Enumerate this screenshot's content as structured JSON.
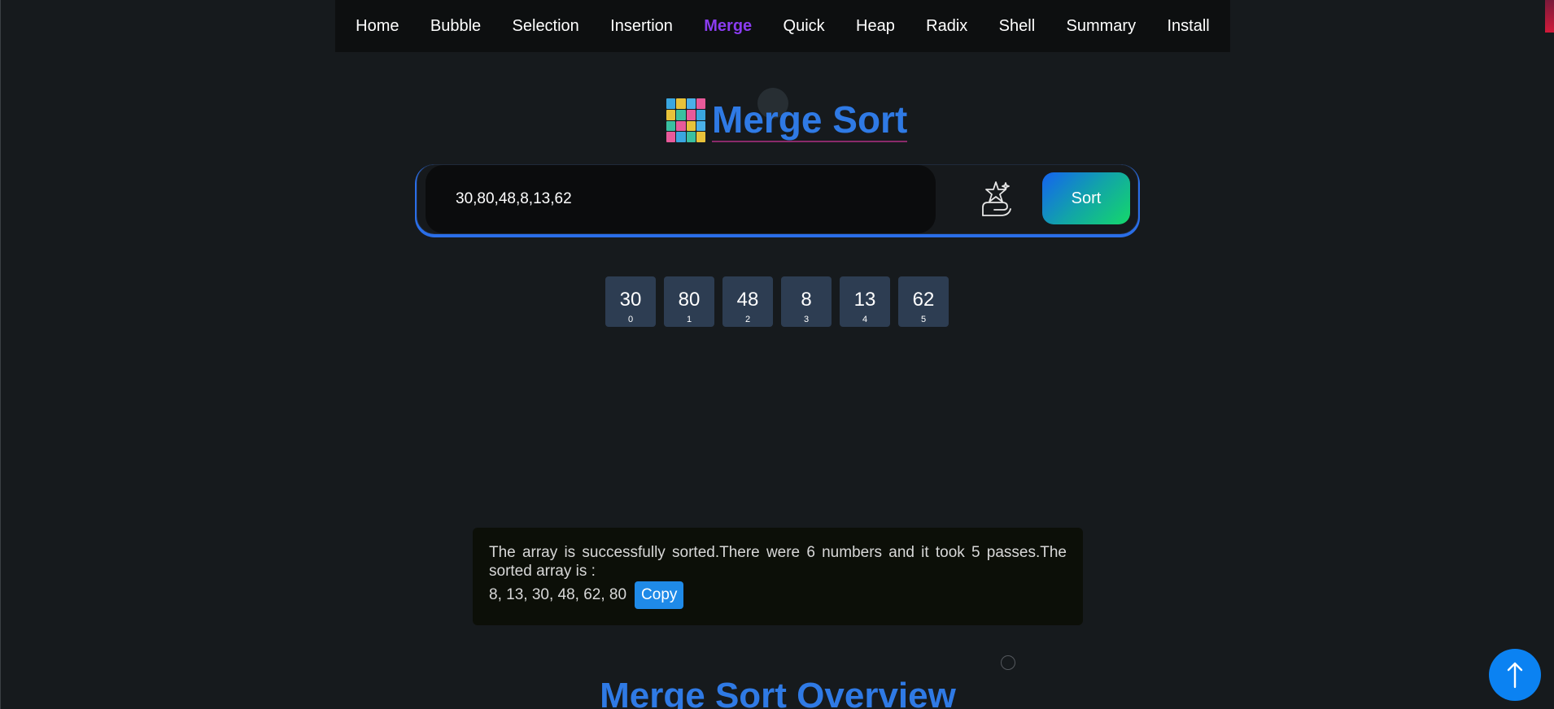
{
  "nav": {
    "items": [
      {
        "label": "Home"
      },
      {
        "label": "Bubble"
      },
      {
        "label": "Selection"
      },
      {
        "label": "Insertion"
      },
      {
        "label": "Merge"
      },
      {
        "label": "Quick"
      },
      {
        "label": "Heap"
      },
      {
        "label": "Radix"
      },
      {
        "label": "Shell"
      },
      {
        "label": "Summary"
      },
      {
        "label": "Install"
      }
    ],
    "active": "Merge"
  },
  "title": "Merge Sort",
  "input": {
    "value": "30,80,48,8,13,62"
  },
  "sort_button": "Sort",
  "array": [
    {
      "value": "30",
      "index": "0"
    },
    {
      "value": "80",
      "index": "1"
    },
    {
      "value": "48",
      "index": "2"
    },
    {
      "value": "8",
      "index": "3"
    },
    {
      "value": "13",
      "index": "4"
    },
    {
      "value": "62",
      "index": "5"
    }
  ],
  "result": {
    "message": "The array is successfully sorted.There were 6 numbers and it took 5 passes.The sorted array is :",
    "sorted": "8, 13, 30, 48, 62, 80",
    "copy_label": "Copy"
  },
  "overview_title": "Merge Sort Overview",
  "icons": {
    "magic": "magic-hand-icon",
    "scroll_top": "arrow-up-icon"
  },
  "colors": {
    "accent": "#2f7ae5",
    "active_nav": "#8a3cf0",
    "box": "#2d3d52",
    "scroll_button": "#0b82f2"
  }
}
